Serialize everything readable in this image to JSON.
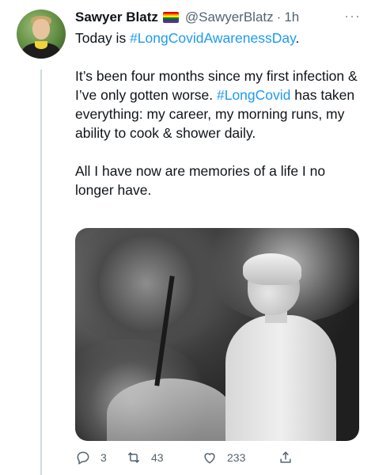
{
  "tweet": {
    "author_name": "Sawyer Blatz",
    "author_handle": "@SawyerBlatz",
    "separator": "·",
    "time": "1h",
    "more_glyph": "···",
    "flag_icon": "rainbow-flag-icon",
    "lines": {
      "l1_pre": "Today is ",
      "l1_tag": "#LongCovidAwarenessDay",
      "l1_post": ".",
      "p2_a": "It’s been four months since my first infection & I’ve only gotten worse. ",
      "p2_tag": "#LongCovid",
      "p2_b": " has taken everything: my career, my morning runs, my ability to cook & shower daily.",
      "p3": "All I have now are memories of a life I no longer have."
    },
    "counts": {
      "replies": "3",
      "retweets": "43",
      "likes": "233"
    }
  },
  "colors": {
    "link": "#1d9bf0",
    "text": "#0f1419",
    "secondary": "#536471"
  }
}
